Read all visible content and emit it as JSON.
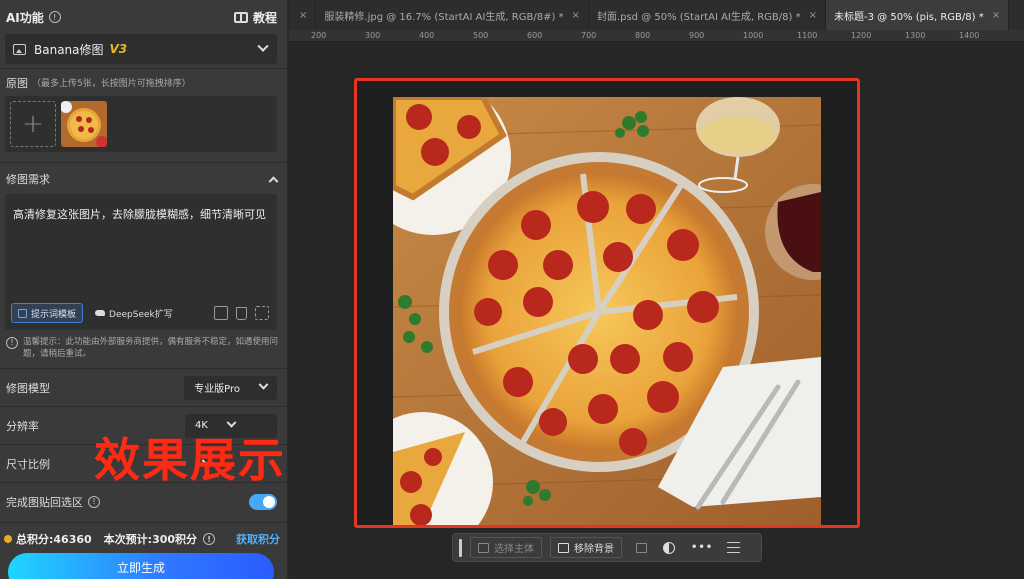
{
  "panel": {
    "title": "AI功能",
    "info_icon": "info-icon",
    "tutorial_label": "教程",
    "model_selector": {
      "name": "Banana修图",
      "version": "V3"
    },
    "original": {
      "label": "原图",
      "hint": "（最多上传5张，长按图片可拖拽排序）"
    },
    "requirement": {
      "label": "修图需求",
      "text": "高清修复这张图片，去除朦胧模糊感，细节清晰可见",
      "template_button": "提示词模板",
      "deepseek_button": "DeepSeek扩写"
    },
    "notice": "温馨提示：此功能由外部服务商提供，偶有服务不稳定，如遇使用问题，请稍后重试。",
    "settings": {
      "model": {
        "label": "修图模型",
        "value": "专业版Pro"
      },
      "resolution": {
        "label": "分辨率",
        "value": "4K"
      },
      "ratio": {
        "label": "尺寸比例"
      },
      "paste_back": {
        "label": "完成图贴回选区",
        "enabled": true
      }
    },
    "footer": {
      "credits": "总积分:46360",
      "estimate": "本次预计:300积分",
      "get_credits": "获取积分",
      "generate_button": "立即生成"
    }
  },
  "tabs": [
    {
      "label": "",
      "active": false
    },
    {
      "label": "服装精修.jpg @ 16.7% (StartAI AI生成, RGB/8#) *",
      "active": false
    },
    {
      "label": "封面.psd @ 50% (StartAI AI生成, RGB/8) *",
      "active": false
    },
    {
      "label": "未标题-3 @ 50% (pis, RGB/8) *",
      "active": true
    }
  ],
  "ruler_ticks": [
    "200",
    "300",
    "400",
    "500",
    "600",
    "700",
    "800",
    "900",
    "1000",
    "1100",
    "1200",
    "1300",
    "1400"
  ],
  "overlay_text": "效果展示",
  "context_bar": {
    "select_subject": "选择主体",
    "remove_background": "移除背景",
    "more": "•••"
  },
  "colors": {
    "accent": "#47a8f5",
    "frame": "#e2361e",
    "version": "#e8b722"
  }
}
